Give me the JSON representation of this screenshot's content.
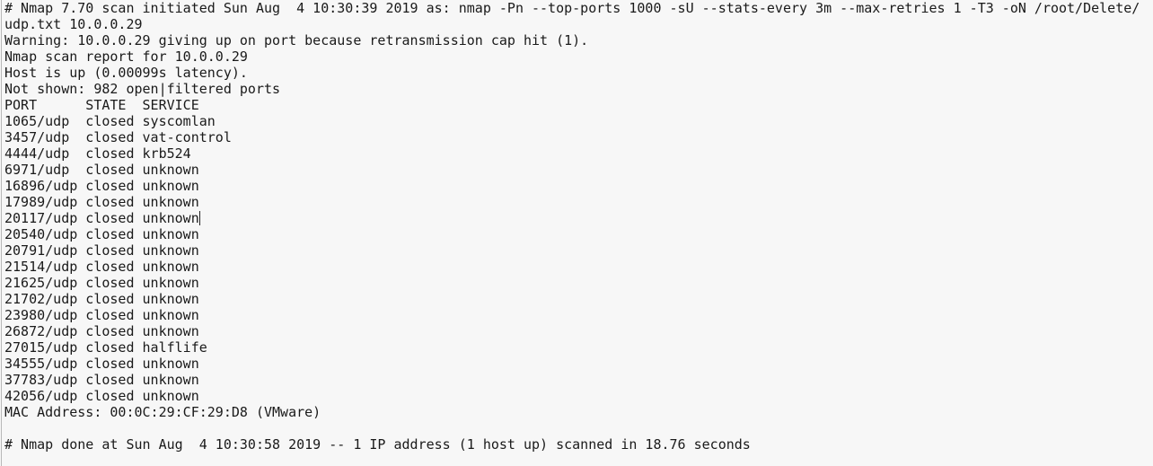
{
  "editor": {
    "lines": [
      "# Nmap 7.70 scan initiated Sun Aug  4 10:30:39 2019 as: nmap -Pn --top-ports 1000 -sU --stats-every 3m --max-retries 1 -T3 -oN /root/Delete/",
      "udp.txt 10.0.0.29",
      "Warning: 10.0.0.29 giving up on port because retransmission cap hit (1).",
      "Nmap scan report for 10.0.0.29",
      "Host is up (0.00099s latency).",
      "Not shown: 982 open|filtered ports",
      "PORT      STATE  SERVICE",
      "1065/udp  closed syscomlan",
      "3457/udp  closed vat-control",
      "4444/udp  closed krb524",
      "6971/udp  closed unknown",
      "16896/udp closed unknown",
      "17989/udp closed unknown",
      "20117/udp closed unknown",
      "20540/udp closed unknown",
      "20791/udp closed unknown",
      "21514/udp closed unknown",
      "21625/udp closed unknown",
      "21702/udp closed unknown",
      "23980/udp closed unknown",
      "26872/udp closed unknown",
      "27015/udp closed halflife",
      "34555/udp closed unknown",
      "37783/udp closed unknown",
      "42056/udp closed unknown",
      "MAC Address: 00:0C:29:CF:29:D8 (VMware)",
      "",
      "# Nmap done at Sun Aug  4 10:30:58 2019 -- 1 IP address (1 host up) scanned in 18.76 seconds"
    ],
    "caret_line": 13
  }
}
